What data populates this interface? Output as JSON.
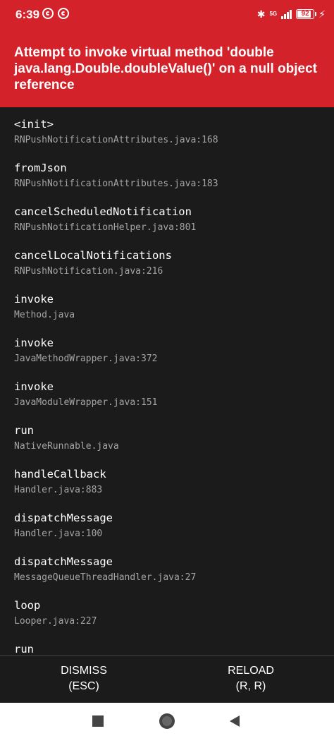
{
  "status_bar": {
    "time": "6:39",
    "network": "5G",
    "battery": "92",
    "battery_level": 0.92
  },
  "error": {
    "title": "Attempt to invoke virtual method 'double java.lang.Double.doubleValue()' on a null object reference"
  },
  "stack_frames": [
    {
      "method": "<init>",
      "file": "RNPushNotificationAttributes.java:168"
    },
    {
      "method": "fromJson",
      "file": "RNPushNotificationAttributes.java:183"
    },
    {
      "method": "cancelScheduledNotification",
      "file": "RNPushNotificationHelper.java:801"
    },
    {
      "method": "cancelLocalNotifications",
      "file": "RNPushNotification.java:216"
    },
    {
      "method": "invoke",
      "file": "Method.java"
    },
    {
      "method": "invoke",
      "file": "JavaMethodWrapper.java:372"
    },
    {
      "method": "invoke",
      "file": "JavaModuleWrapper.java:151"
    },
    {
      "method": "run",
      "file": "NativeRunnable.java"
    },
    {
      "method": "handleCallback",
      "file": "Handler.java:883"
    },
    {
      "method": "dispatchMessage",
      "file": "Handler.java:100"
    },
    {
      "method": "dispatchMessage",
      "file": "MessageQueueThreadHandler.java:27"
    },
    {
      "method": "loop",
      "file": "Looper.java:227"
    },
    {
      "method": "run",
      "file": ""
    }
  ],
  "buttons": {
    "dismiss_label": "DISMISS",
    "dismiss_shortcut": "(ESC)",
    "reload_label": "RELOAD",
    "reload_shortcut": "(R, R)"
  },
  "colors": {
    "header": "#d4222b",
    "background": "#1b1b1b",
    "file_text": "#a5a5a5"
  }
}
